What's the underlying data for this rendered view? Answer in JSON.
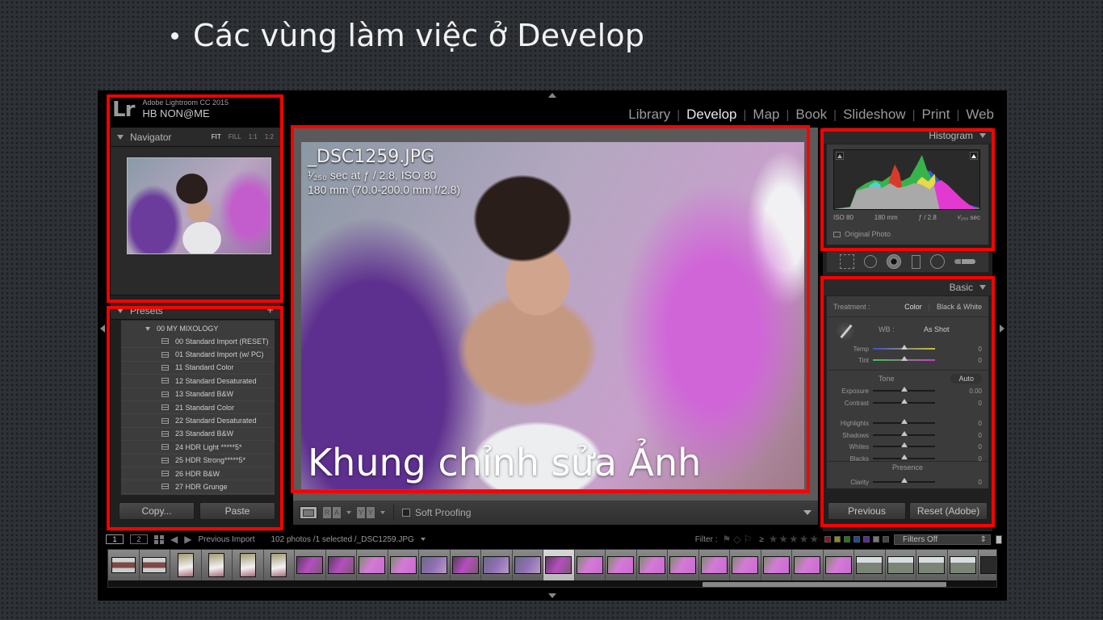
{
  "slide": {
    "title": "Các vùng làm việc ở Develop"
  },
  "identity_plate": {
    "logo": "Lr",
    "app_name": "Adobe Lightroom CC 2015",
    "user_name": "HB NON@ME"
  },
  "modules": [
    {
      "label": "Library",
      "active": false
    },
    {
      "label": "Develop",
      "active": true
    },
    {
      "label": "Map",
      "active": false
    },
    {
      "label": "Book",
      "active": false
    },
    {
      "label": "Slideshow",
      "active": false
    },
    {
      "label": "Print",
      "active": false
    },
    {
      "label": "Web",
      "active": false
    }
  ],
  "navigator": {
    "title": "Navigator",
    "zoom_options": [
      "FIT",
      "FILL",
      "1:1",
      "1:2"
    ],
    "active_zoom": "FIT"
  },
  "presets": {
    "title": "Presets",
    "add_symbol": "+",
    "folder": "00 MY MIXOLOGY",
    "items": [
      "00 Standard Import (RESET)",
      "01 Standard Import (w/ PC)",
      "11 Standard Color",
      "12 Standard Desaturated",
      "13 Standard B&W",
      "21 Standard Color",
      "22 Standard Desaturated",
      "23 Standard B&W",
      "24 HDR Light *****5*",
      "25 HDR Strong*****5*",
      "26 HDR B&W",
      "27 HDR Grunge"
    ],
    "copy_label": "Copy...",
    "paste_label": "Paste"
  },
  "photo": {
    "filename": "_DSC1259.JPG",
    "exposure_line": "¹⁄₂₅₀ sec at ƒ / 2.8, ISO 80",
    "lens_line": "180 mm (70.0-200.0 mm f/2.8)",
    "caption": "Khung chỉnh sửa Ảnh"
  },
  "toolbar": {
    "before_after_left": "R",
    "before_after_right": "A",
    "yy_left": "Y",
    "yy_right": "Y",
    "soft_proofing_label": "Soft Proofing",
    "soft_proofing_checked": false
  },
  "histogram": {
    "title": "Histogram",
    "iso": "ISO 80",
    "focal": "180 mm",
    "aperture": "ƒ / 2.8",
    "shutter": "¹⁄₂₅₀ sec",
    "original_photo_label": "Original Photo",
    "original_photo_checked": false
  },
  "tools": [
    "crop-overlay",
    "spot-removal",
    "red-eye",
    "graduated-filter",
    "radial-filter",
    "adjustment-brush"
  ],
  "basic": {
    "title": "Basic",
    "treatment_label": "Treatment :",
    "treatment_color": "Color",
    "treatment_bw": "Black & White",
    "treatment_selected": "Color",
    "wb_label": "WB :",
    "wb_value": "As Shot",
    "tone_label": "Tone",
    "auto_label": "Auto",
    "presence_label": "Presence",
    "sliders": {
      "temp": {
        "label": "Temp",
        "value": "0",
        "position": 0.5
      },
      "tint": {
        "label": "Tint",
        "value": "0",
        "position": 0.5
      },
      "exposure": {
        "label": "Exposure",
        "value": "0.00",
        "position": 0.5
      },
      "contrast": {
        "label": "Contrast",
        "value": "0",
        "position": 0.5
      },
      "highlights": {
        "label": "Highlights",
        "value": "0",
        "position": 0.5
      },
      "shadows": {
        "label": "Shadows",
        "value": "0",
        "position": 0.5
      },
      "whites": {
        "label": "Whites",
        "value": "0",
        "position": 0.5
      },
      "blacks": {
        "label": "Blacks",
        "value": "0",
        "position": 0.5
      },
      "clarity": {
        "label": "Clarity",
        "value": "0",
        "position": 0.5
      }
    },
    "previous_label": "Previous",
    "reset_label": "Reset (Adobe)"
  },
  "filmstrip_bar": {
    "screen1": "1",
    "screen2": "2",
    "source": "Previous Import",
    "count": "102 photos /1 selected /_DSC1259.JPG",
    "filter_label": "Filter :",
    "rating_op": "≥",
    "stars": "★★★★★",
    "color_labels": [
      "#8b1a1a",
      "#8a8a1a",
      "#1a7a1a",
      "#1a4a9a",
      "#5a2a9a",
      "#777777",
      "#444444"
    ],
    "filter_preset": "Filters Off"
  },
  "filmstrip": {
    "thumbs": [
      "building",
      "building",
      "bride",
      "bride",
      "bride",
      "bride",
      "purple",
      "purple",
      "pink",
      "pink",
      "lavender",
      "purple",
      "lavender",
      "lavender",
      "purple",
      "pink",
      "pink",
      "pink",
      "pink",
      "pink",
      "pink",
      "pink",
      "pink",
      "pink",
      "landscape",
      "landscape",
      "landscape",
      "landscape",
      "dark"
    ],
    "selected_index": 14
  }
}
